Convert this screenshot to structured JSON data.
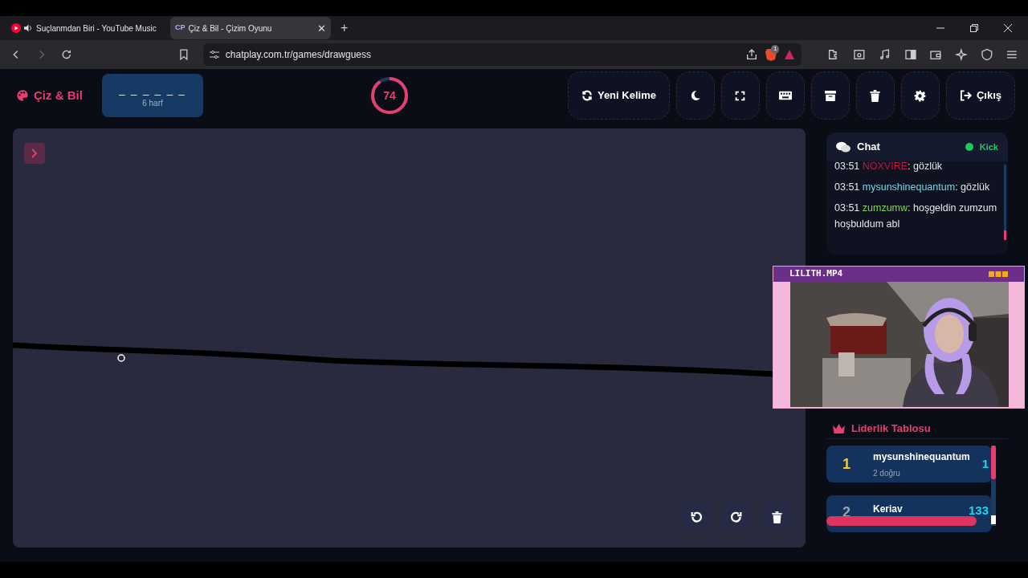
{
  "browser": {
    "tabs": [
      {
        "title": "Suçlanmdan Biri - YouTube Music",
        "selected": false,
        "audio": true
      },
      {
        "title": "Çiz & Bil - Çizim Oyunu",
        "selected": true,
        "audio": false,
        "favicon_text": "CP",
        "close": "✕"
      }
    ],
    "new_tab": "+",
    "address": "chatplay.com.tr/games/drawguess",
    "shield_count": "1"
  },
  "header": {
    "logo": "Çiz & Bil",
    "word_mask": "_ _ _ _ _ _",
    "word_hint": "6 harf",
    "timer": {
      "value": "74"
    },
    "buttons": [
      {
        "kind": "refresh",
        "label": "Yeni Kelime"
      },
      {
        "kind": "moon"
      },
      {
        "kind": "fullscreen"
      },
      {
        "kind": "keyboard"
      },
      {
        "kind": "archive"
      },
      {
        "kind": "trash"
      },
      {
        "kind": "gear"
      },
      {
        "kind": "exit",
        "label": "Çıkış"
      }
    ]
  },
  "canvas": {
    "tools": [
      {
        "kind": "undo"
      },
      {
        "kind": "redo"
      },
      {
        "kind": "trash"
      }
    ]
  },
  "chat": {
    "title": "Chat",
    "platform": "Kick",
    "messages": [
      {
        "time": "03:51",
        "user": "NOXVIRE",
        "color": "#c0183f",
        "text": ": gözlük"
      },
      {
        "time": "03:51",
        "user": "mysunshinequantum",
        "color": "#7dd3e0",
        "text": ": gözlük"
      },
      {
        "time": "03:51",
        "user": "zumzumw",
        "color": "#7ed957",
        "text": ": hoşgeldin zumzum hoşbuldum abl"
      }
    ]
  },
  "video": {
    "title": "LILITH.MP4"
  },
  "leaderboard": {
    "title": "Liderlik Tablosu",
    "rows": [
      {
        "rank": "1",
        "name": "mysunshinequantum",
        "detail": "2 doğru",
        "score": "1",
        "color": "#facc15"
      },
      {
        "rank": "2",
        "name": "Keriav",
        "score": "133",
        "color": "#9ca3af"
      }
    ]
  }
}
